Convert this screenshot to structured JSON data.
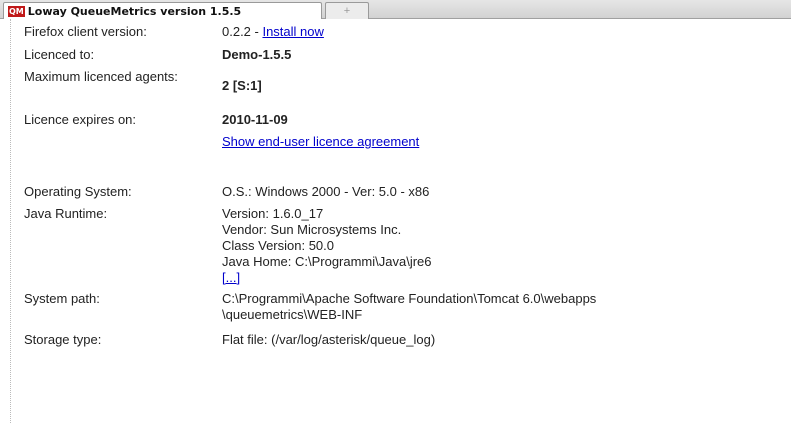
{
  "tab": {
    "logo": "QM",
    "title": "Loway QueueMetrics version 1.5.5",
    "new_tab_glyph": "+"
  },
  "info": {
    "firefox_label": "Firefox client version:",
    "firefox_version": "0.2.2 - ",
    "install_now": "Install now",
    "licenced_to_label": "Licenced to:",
    "licenced_to": "Demo-1.5.5",
    "max_agents_label": "Maximum licenced agents:",
    "max_agents": "2 [S:1]",
    "expires_label": "Licence expires on:",
    "expires": "2010-11-09",
    "eula_link": "Show end-user licence agreement",
    "os_label": "Operating System:",
    "os": "O.S.: Windows 2000 - Ver: 5.0 - x86",
    "java_label": "Java Runtime:",
    "java_version": "Version: 1.6.0_17",
    "java_vendor": "Vendor: Sun Microsystems Inc.",
    "java_class": "Class Version: 50.0",
    "java_home": "Java Home: C:\\Programmi\\Java\\jre6",
    "java_more": "[...]",
    "syspath_label": "System path:",
    "syspath_line1": "C:\\Programmi\\Apache Software Foundation\\Tomcat 6.0\\webapps",
    "syspath_line2": "\\queuemetrics\\WEB-INF",
    "storage_label": "Storage type:",
    "storage": "Flat file: (/var/log/asterisk/queue_log)"
  }
}
